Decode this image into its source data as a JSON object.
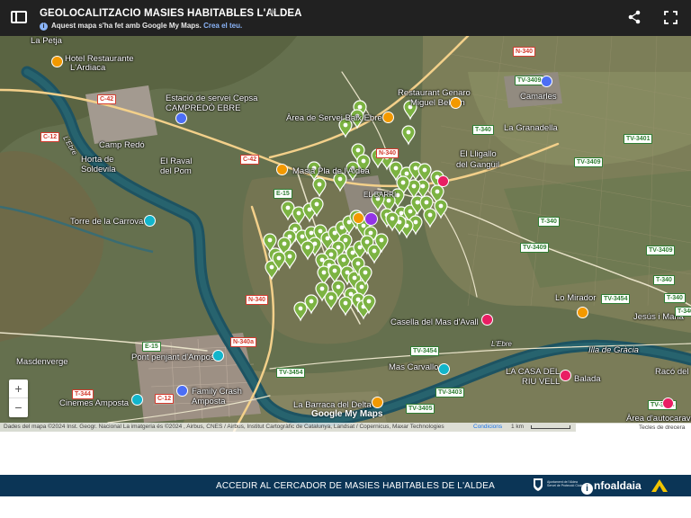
{
  "header": {
    "title": "GEOLOCALITZACIO MASIES HABITABLES L'ALDEA",
    "subtitle": "Aquest mapa s'ha fet amb Google My Maps.",
    "create_link": "Crea el teu."
  },
  "map": {
    "place_labels": [
      {
        "text": "La Petja"
      },
      {
        "text": "Hotel Restaurante"
      },
      {
        "text": "L'Ardiaca"
      },
      {
        "text": "Estació de servei Cepsa"
      },
      {
        "text": "CAMPREDÓ EBRE"
      },
      {
        "text": "Restaurant Genaro"
      },
      {
        "text": "Miguel Beltrán"
      },
      {
        "text": "Camarles"
      },
      {
        "text": "Àrea de Servei Baix Ebre"
      },
      {
        "text": "La Granadella"
      },
      {
        "text": "Camp Redó"
      },
      {
        "text": "Horta de"
      },
      {
        "text": "Soldevila"
      },
      {
        "text": "El Raval"
      },
      {
        "text": "del Pom"
      },
      {
        "text": "Masia Pla de l'Aldea"
      },
      {
        "text": "L'Illgallo"
      },
      {
        "text": "del Gangüil"
      },
      {
        "text": "EL BARRI"
      },
      {
        "text": "Torre de la Carrova"
      },
      {
        "text": "Lo Mirador"
      },
      {
        "text": "Jesús i Maria"
      },
      {
        "text": "Casella del Mas d'Avall"
      },
      {
        "text": "L'Ebre"
      },
      {
        "text": "Illa de Gràcia"
      },
      {
        "text": "Masdenverge"
      },
      {
        "text": "Pont penjant d'Amposta"
      },
      {
        "text": "Mas Carvallo"
      },
      {
        "text": "LA CASA DEL"
      },
      {
        "text": "RIU VELL"
      },
      {
        "text": "Balada"
      },
      {
        "text": "Racó del"
      },
      {
        "text": "Family Crash"
      },
      {
        "text": "Amposta"
      },
      {
        "text": "Cinemes Amposta"
      },
      {
        "text": "La Barraca del Delta"
      },
      {
        "text": "Àrea d'autocaravanes"
      },
      {
        "text": "L'Ebre"
      },
      {
        "text": "El Lligallo"
      }
    ],
    "road_labels": [
      "N-340",
      "C-42",
      "C-12",
      "C-42",
      "N-340",
      "TV-3409",
      "T-340",
      "TV-3401",
      "TV-3409",
      "E-15",
      "T-340",
      "TV-3409",
      "TV-3409",
      "T-340",
      "TV-3454",
      "T-340",
      "T-340",
      "N-340",
      "N-340a",
      "E-15",
      "TV-3454",
      "TV-3454",
      "TV-3403",
      "TV-3405",
      "T-344",
      "C-12",
      "TV-3403"
    ],
    "markers": [
      {
        "type": "masia",
        "color": "#7cb342"
      },
      {
        "type": "restaurant",
        "color": "#f29900"
      },
      {
        "type": "hotel",
        "color": "#e91e63"
      },
      {
        "type": "attraction",
        "color": "#12b5cb"
      },
      {
        "type": "gas-station",
        "color": "#4c6ef5"
      },
      {
        "type": "hospital",
        "color": "#9334e6"
      }
    ],
    "zoom": {
      "in_label": "+",
      "out_label": "−"
    },
    "google_logo": "Google My Maps",
    "attribution": "Dades del mapa ©2024 Inst. Geogr. Nacional La imatgeria és ©2024 , Airbus, CNES / Airbus, Institut Cartogràfic de Catalunya, Landsat / Copernicus, Maxar Technologies",
    "terms": "Condicions",
    "scale": "1 km",
    "shortcuts": "Tecles de drecera"
  },
  "footer": {
    "cta": "ACCEDIR AL CERCADOR DE MASIES HABITABLES DE L'ALDEA",
    "ajuntament_line1": "Ajuntament de l'Aldea",
    "ajuntament_line2": "Servei de Protecció Ciutadana",
    "infoaldea": "nfoaldaia"
  }
}
